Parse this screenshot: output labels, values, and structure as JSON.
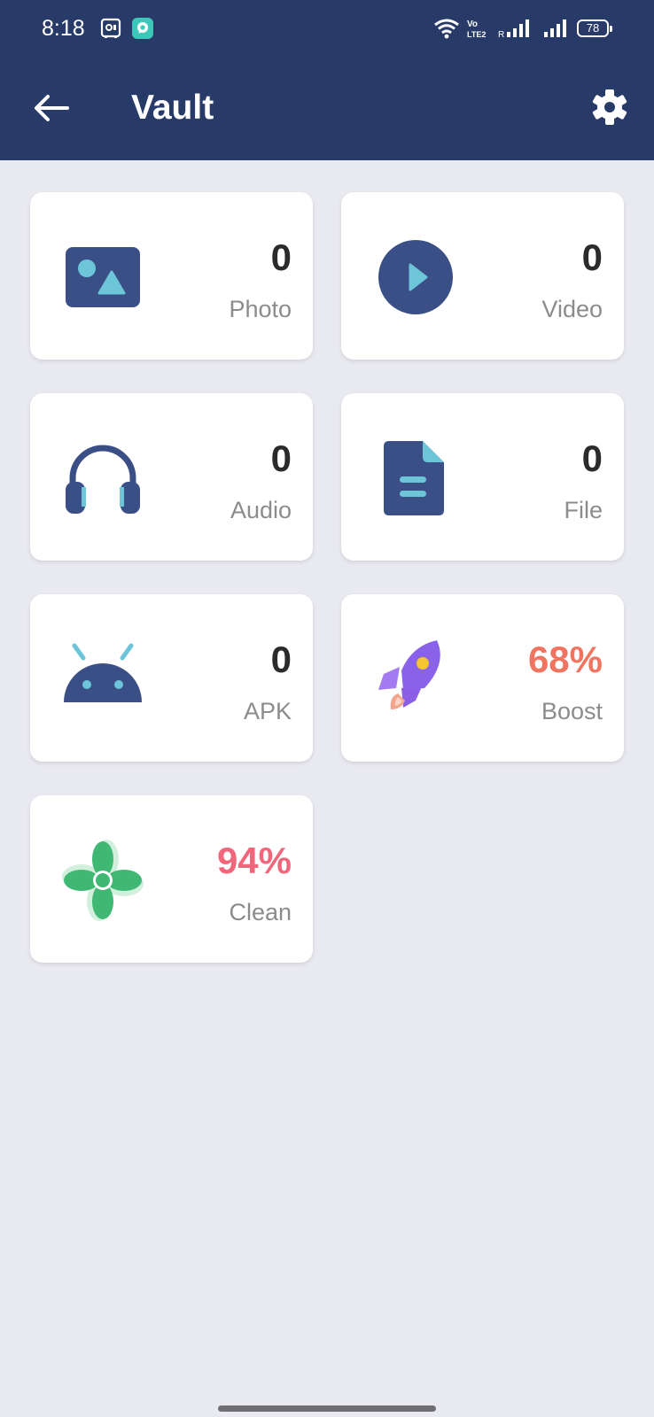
{
  "status_bar": {
    "time": "8:18",
    "battery": "78",
    "icons": [
      "storage-icon",
      "chat-icon",
      "wifi-icon",
      "volte-icon",
      "signal-icon",
      "signal-icon",
      "battery-icon"
    ]
  },
  "header": {
    "title": "Vault",
    "back_icon": "arrow-left-icon",
    "settings_icon": "gear-icon"
  },
  "cards": [
    {
      "id": "photo",
      "count": "0",
      "label": "Photo",
      "icon": "photo-icon"
    },
    {
      "id": "video",
      "count": "0",
      "label": "Video",
      "icon": "video-icon"
    },
    {
      "id": "audio",
      "count": "0",
      "label": "Audio",
      "icon": "headphones-icon"
    },
    {
      "id": "file",
      "count": "0",
      "label": "File",
      "icon": "file-icon"
    },
    {
      "id": "apk",
      "count": "0",
      "label": "APK",
      "icon": "android-icon"
    },
    {
      "id": "boost",
      "count": "68%",
      "label": "Boost",
      "icon": "rocket-icon"
    },
    {
      "id": "clean",
      "count": "94%",
      "label": "Clean",
      "icon": "fan-icon"
    }
  ],
  "colors": {
    "header_bg": "#283a67",
    "page_bg": "#e9e9f0",
    "icon_primary": "#35497f",
    "icon_accent": "#6cc6d8",
    "boost_accent": "#f07560",
    "clean_accent": "#f0667a"
  }
}
